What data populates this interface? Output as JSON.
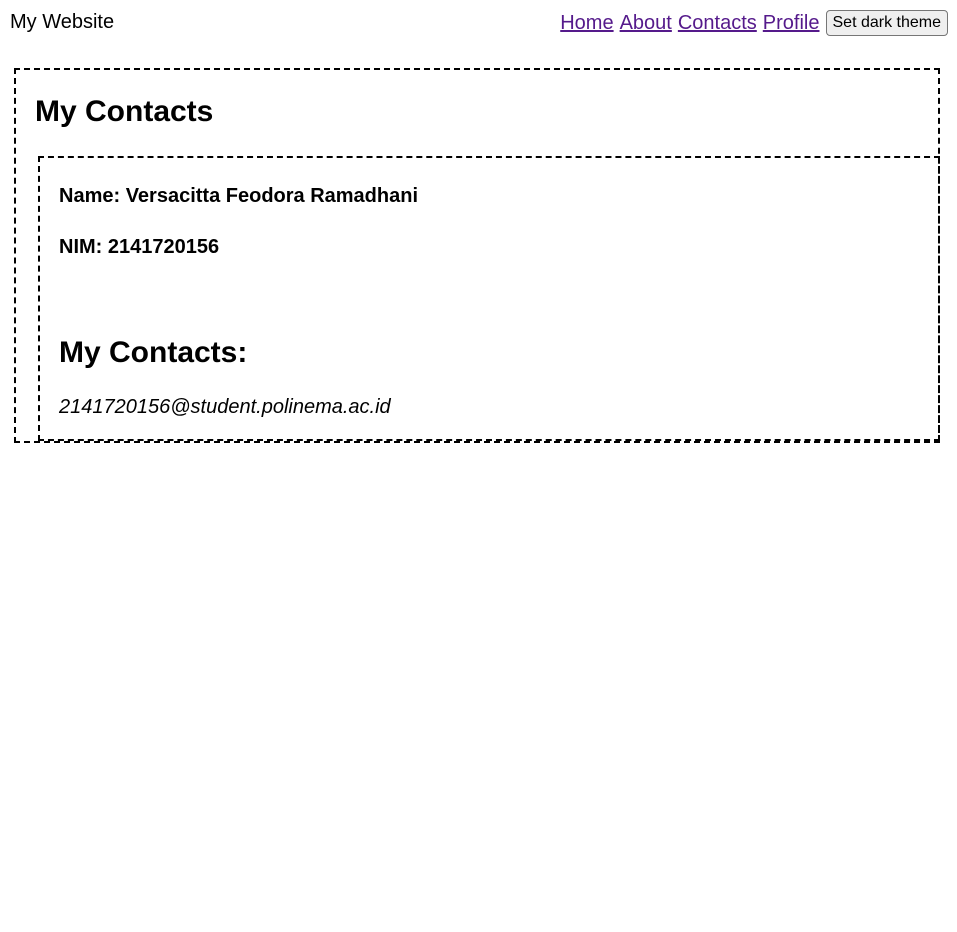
{
  "header": {
    "brand": "My Website",
    "nav": {
      "home": "Home",
      "about": "About",
      "contacts": "Contacts",
      "profile": "Profile"
    },
    "theme_button": "Set dark theme"
  },
  "main": {
    "title": "My Contacts",
    "profile": {
      "name_line": "Name: Versacitta Feodora Ramadhani",
      "nim_line": "NIM: 2141720156",
      "contacts_heading": "My Contacts:",
      "email": "2141720156@student.polinema.ac.id"
    }
  },
  "colors": {
    "link": "#551a8b",
    "text": "#000000",
    "background": "#ffffff",
    "border": "#000000"
  }
}
